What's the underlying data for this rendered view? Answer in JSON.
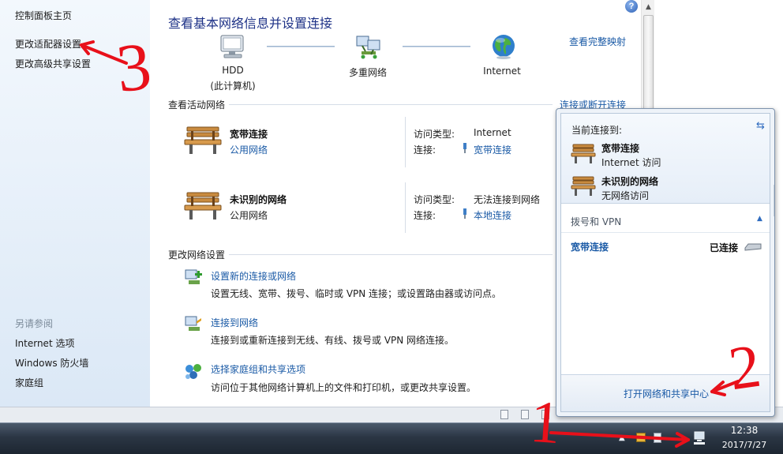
{
  "sidebar": {
    "home": "控制面板主页",
    "adapter": "更改适配器设置",
    "advanced": "更改高级共享设置",
    "see_also": "另请参阅",
    "internet_options": "Internet 选项",
    "firewall": "Windows 防火墙",
    "homegroup": "家庭组"
  },
  "main": {
    "title": "查看基本网络信息并设置连接",
    "full_map": "查看完整映射",
    "map": {
      "computer_name": "HDD",
      "computer_sub": "(此计算机)",
      "multi": "多重网络",
      "internet": "Internet"
    },
    "active_header": "查看活动网络",
    "connect_disconnect": "连接或断开连接",
    "networks": [
      {
        "name": "宽带连接",
        "kind": "公用网络",
        "access_label": "访问类型:",
        "access_value": "Internet",
        "conn_label": "连接:",
        "conn_value": "宽带连接"
      },
      {
        "name": "未识别的网络",
        "kind": "公用网络",
        "access_label": "访问类型:",
        "access_value": "无法连接到网络",
        "conn_label": "连接:",
        "conn_value": "本地连接"
      }
    ],
    "change_header": "更改网络设置",
    "tasks": [
      {
        "title": "设置新的连接或网络",
        "desc": "设置无线、宽带、拨号、临时或 VPN 连接；或设置路由器或访问点。"
      },
      {
        "title": "连接到网络",
        "desc": "连接到或重新连接到无线、有线、拨号或 VPN 网络连接。"
      },
      {
        "title": "选择家庭组和共享选项",
        "desc": "访问位于其他网络计算机上的文件和打印机，或更改共享设置。"
      }
    ]
  },
  "popup": {
    "current_label": "当前连接到:",
    "connections": [
      {
        "name": "宽带连接",
        "status": "Internet 访问"
      },
      {
        "name": "未识别的网络",
        "status": "无网络访问"
      }
    ],
    "vpn_header": "拨号和 VPN",
    "vpn_item": "宽带连接",
    "vpn_status": "已连接",
    "open_center": "打开网络和共享中心"
  },
  "taskbar": {
    "time": "12:38",
    "date": "2017/7/27"
  },
  "annotations": {
    "one": "1",
    "two": "2",
    "three": "3"
  },
  "colors": {
    "link": "#1a5aa6",
    "title": "#1e3287",
    "annotation": "#e8101a"
  }
}
